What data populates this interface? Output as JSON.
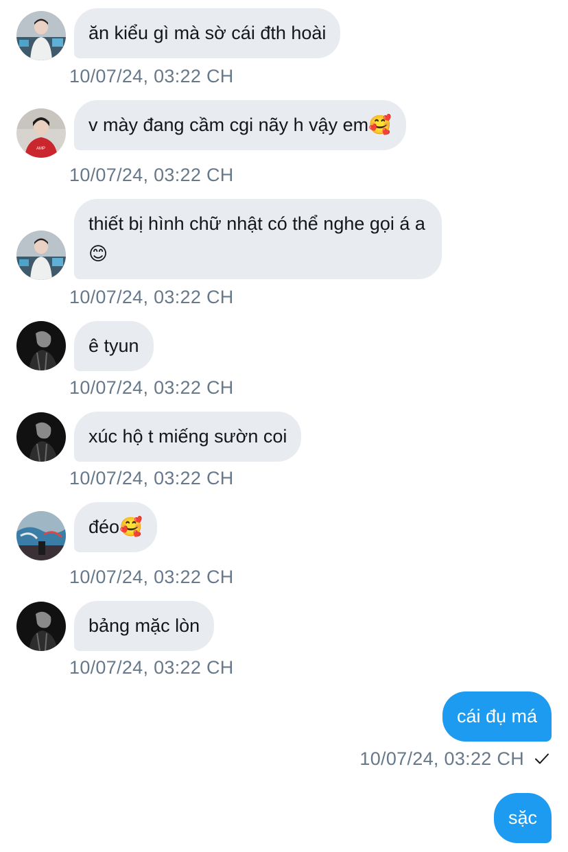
{
  "messages": [
    {
      "text": "ăn kiểu gì mà sờ cái đth hoài",
      "time": "10/07/24, 03:22 CH",
      "avatar": "avatar-user-a"
    },
    {
      "text": "v mày đang cầm cgi nãy h vậy em🥰",
      "time": "10/07/24, 03:22 CH",
      "avatar": "avatar-user-b"
    },
    {
      "text": "thiết bị hình chữ nhật có thể nghe gọi á a😊",
      "time": "10/07/24, 03:22 CH",
      "avatar": "avatar-user-a"
    },
    {
      "text": "ê tyun",
      "time": "10/07/24, 03:22 CH",
      "avatar": "avatar-user-c"
    },
    {
      "text": "xúc hộ t miếng sườn coi",
      "time": "10/07/24, 03:22 CH",
      "avatar": "avatar-user-c"
    },
    {
      "text": "đéo🥰",
      "time": "10/07/24, 03:22 CH",
      "avatar": "avatar-user-d"
    },
    {
      "text": "bảng mặc lòn",
      "time": "10/07/24, 03:22 CH",
      "avatar": "avatar-user-c"
    }
  ],
  "outgoing": [
    {
      "text": "cái đụ má",
      "time": "10/07/24, 03:22 CH",
      "status_icon": "checkmark-icon"
    },
    {
      "text": "sặc"
    }
  ],
  "colors": {
    "incoming_bubble": "#e8ecf0",
    "outgoing_bubble": "#1d9bf0",
    "timestamp": "#66788a"
  }
}
